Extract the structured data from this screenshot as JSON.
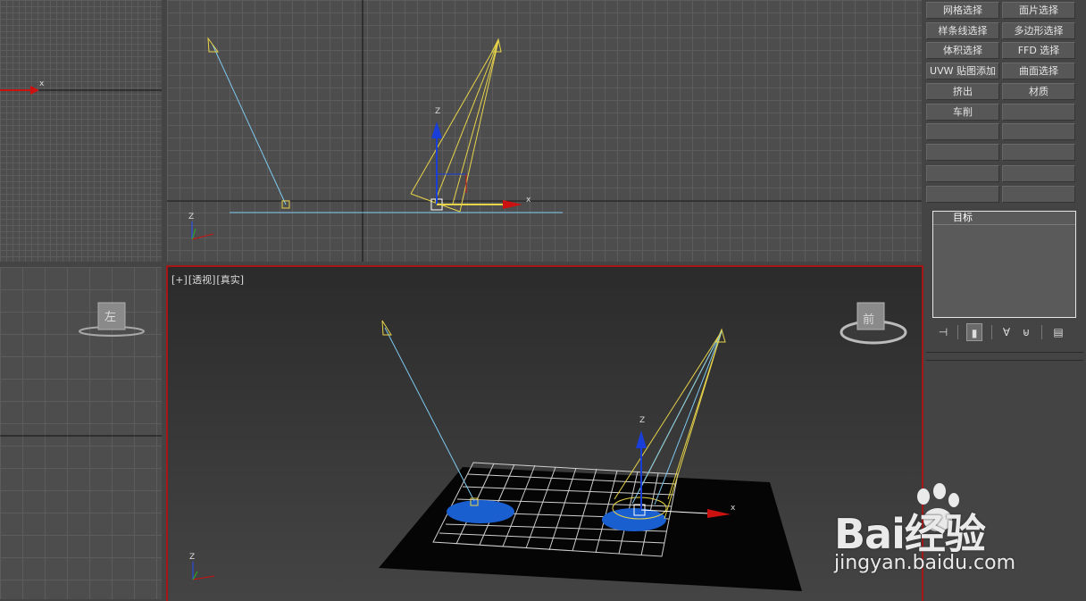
{
  "viewports": {
    "top_left": {
      "axis_x": "x"
    },
    "top": {
      "axis_x": "x",
      "axis_z": "Z",
      "tripod_z": "Z"
    },
    "left": {
      "viewcube_face": "左"
    },
    "perspective": {
      "label_plus": "[+]",
      "label_view": "[透视]",
      "label_shading": "[真实]",
      "viewcube_face": "前",
      "axis_x": "x",
      "axis_z": "Z",
      "tripod_z": "Z"
    }
  },
  "command_panel": {
    "modifier_buttons": [
      "网格选择",
      "面片选择",
      "样条线选择",
      "多边形选择",
      "体积选择",
      "FFD 选择",
      "UVW 贴图添加",
      "曲面选择",
      "挤出",
      "材质",
      "车削",
      "",
      "",
      "",
      "",
      "",
      "",
      "",
      "",
      ""
    ],
    "stack": {
      "items": [
        "目标"
      ]
    },
    "stack_tools": [
      "pin-stack-icon",
      "show-end-result-icon",
      "make-unique-icon",
      "remove-modifier-icon",
      "configure-modifier-sets-icon"
    ]
  },
  "watermark": {
    "brand": "Bai经验",
    "url": "jingyan.baidu.com"
  },
  "colors": {
    "active_viewport_border": "#a51616",
    "light_arrow": "#e8d44a",
    "free_light_line": "#7ec8f0",
    "hotspot": "#1a5fd0",
    "gizmo_z": "#1a3fd8",
    "gizmo_x": "#cc1111"
  }
}
